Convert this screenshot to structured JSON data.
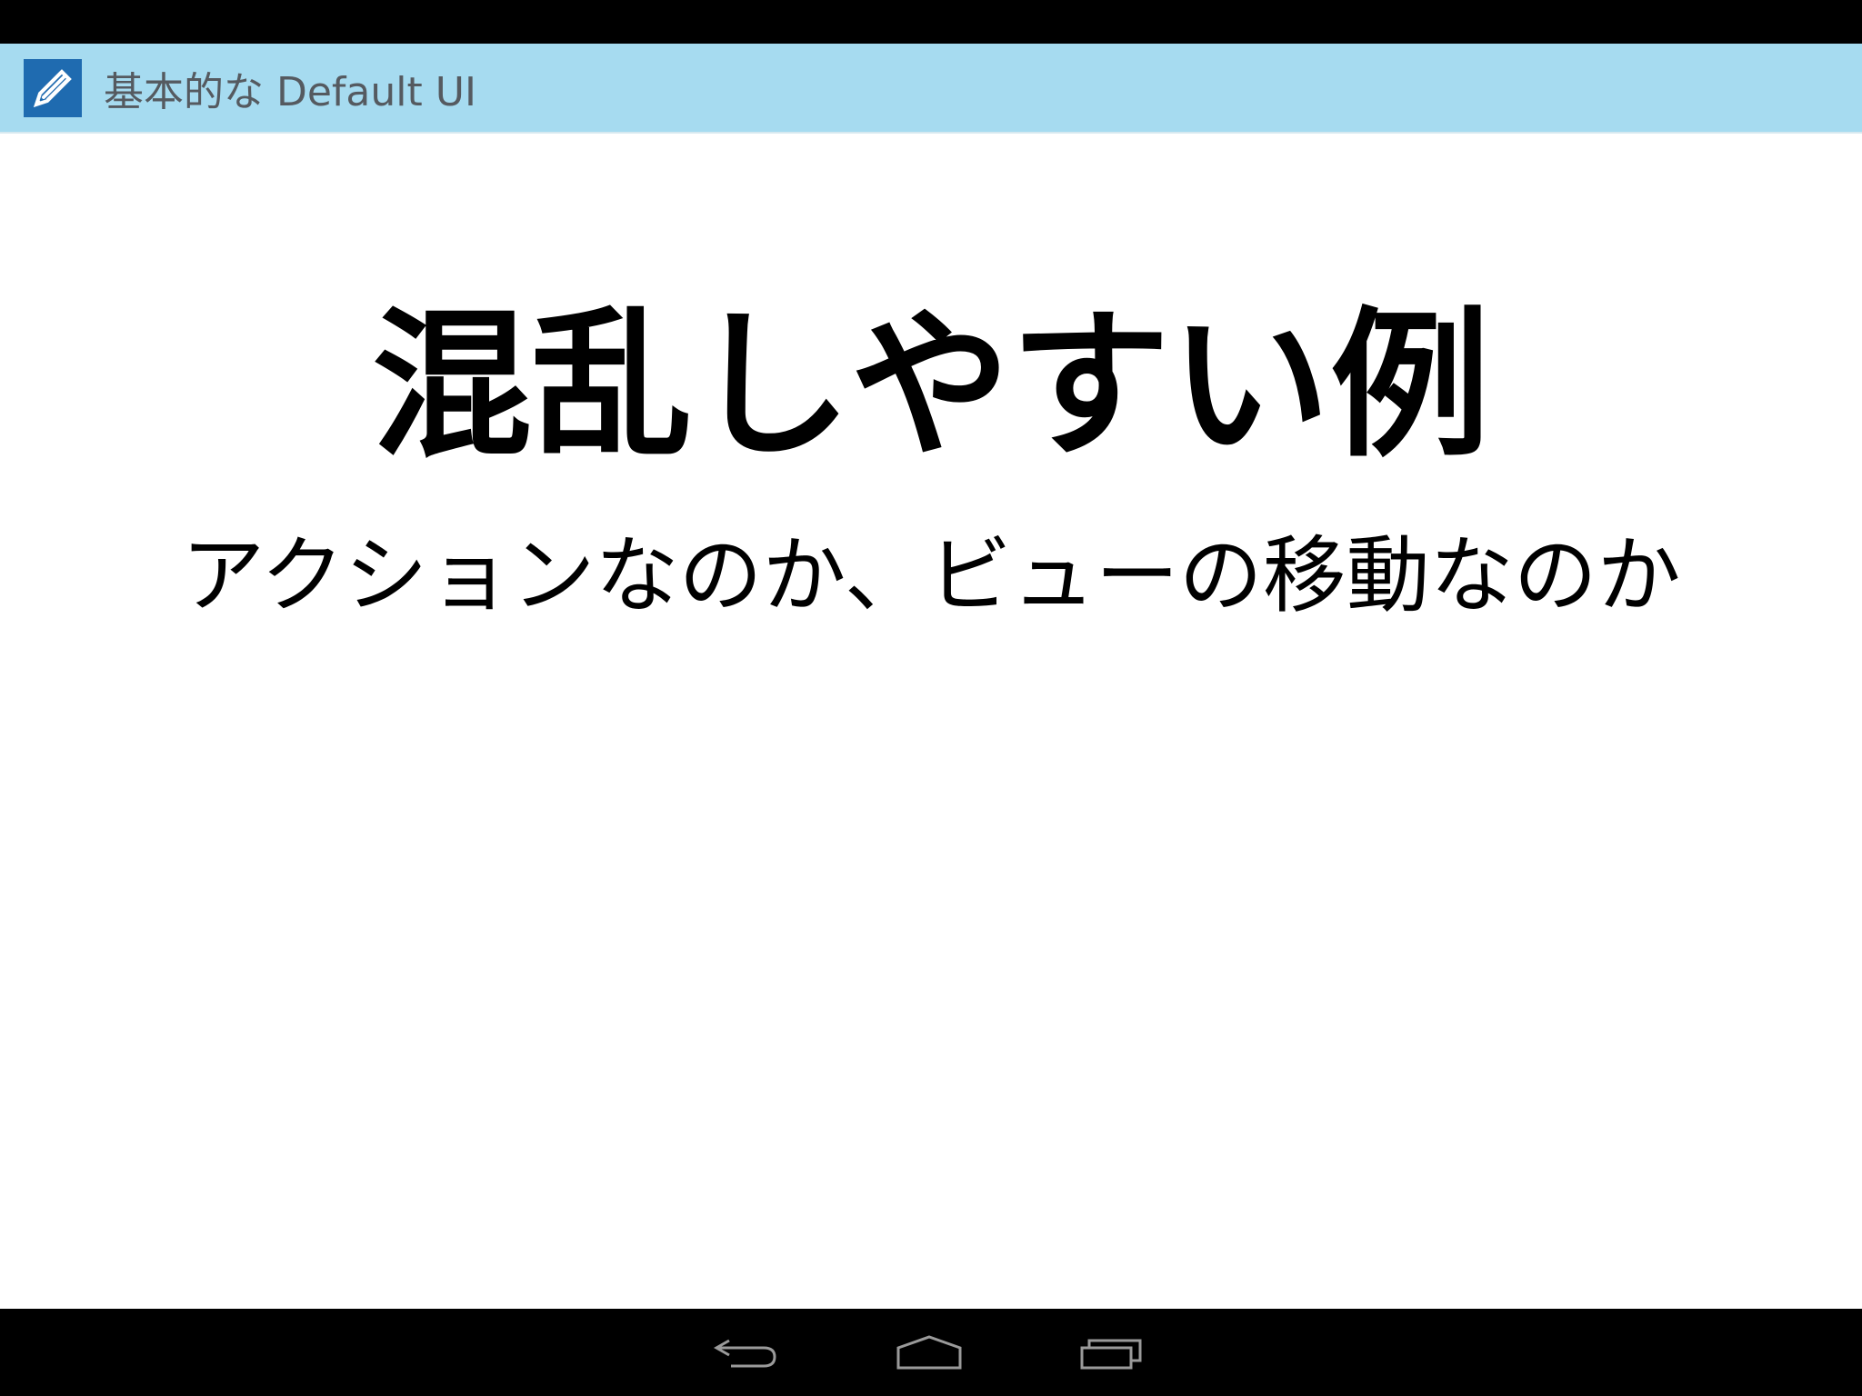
{
  "app": {
    "title": "基本的な Default UI",
    "icon": "pencil-icon",
    "accent_color": "#a6dbf0",
    "icon_bg_color": "#1f6bb0"
  },
  "main": {
    "headline": "混乱しやすい例",
    "subtitle": "アクションなのか、ビューの移動なのか"
  },
  "navigation": {
    "buttons": [
      {
        "icon": "back-icon"
      },
      {
        "icon": "home-icon"
      },
      {
        "icon": "recent-apps-icon"
      }
    ]
  }
}
